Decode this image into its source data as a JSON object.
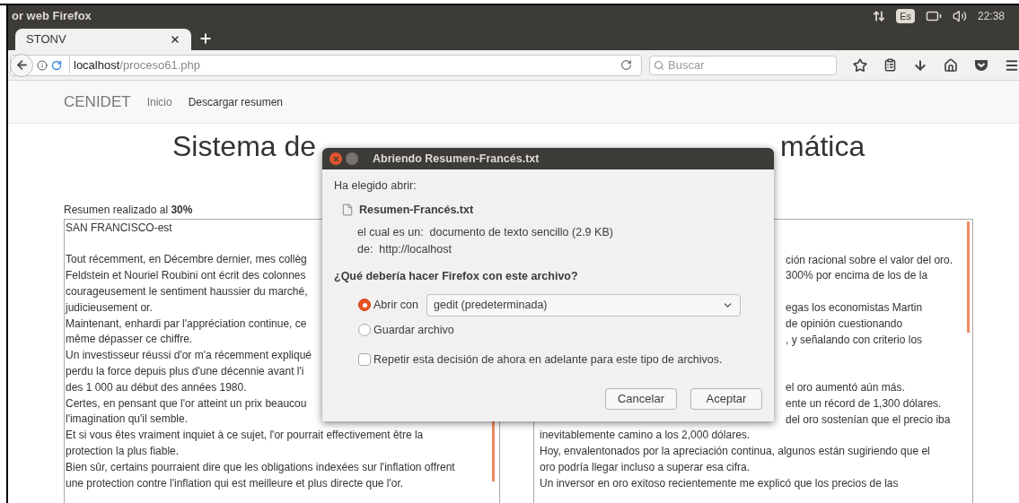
{
  "system_bar": {
    "window_title": "or web Firefox",
    "keyboard": "Es",
    "clock": "22:38"
  },
  "tabs": [
    {
      "label": "STONV",
      "selected": true
    }
  ],
  "address_bar": {
    "host": "localhost",
    "path": "/proceso61.php"
  },
  "search": {
    "placeholder": "Buscar"
  },
  "navbar": {
    "brand": "CENIDET",
    "links": [
      {
        "label": "Inicio",
        "selected": false
      },
      {
        "label": "Descargar resumen",
        "selected": true
      }
    ]
  },
  "page": {
    "title_left": "Sistema de",
    "title_right": "mática",
    "progress_label": "Resumen realizado al **30%**",
    "source_lines": [
      {
        "kind": "text",
        "text": "SAN FRANCISCO-est"
      },
      {
        "kind": "blank"
      },
      {
        "kind": "text",
        "text": "Tout récemment, en Décembre dernier, mes collèg"
      },
      {
        "kind": "text",
        "text": "Feldstein et Nouriel Roubini ont écrit des colonnes"
      },
      {
        "kind": "text",
        "text": "courageusement le sentiment haussier du marché,"
      },
      {
        "kind": "text",
        "text": "judicieusement or."
      },
      {
        "kind": "text",
        "text": "Maintenant, enhardi par l'appréciation continue, ce"
      },
      {
        "kind": "text",
        "text": "même dépasser ce chiffre."
      },
      {
        "kind": "text",
        "text": "Un investisseur réussi d'or m'a récemment expliqué"
      },
      {
        "kind": "text",
        "text": "perdu la force depuis plus d'une décennie avant l'i"
      },
      {
        "kind": "text",
        "text": "des 1 000 au début des années 1980."
      },
      {
        "kind": "text",
        "text": "Certes, en pensant que l'or atteint un prix beaucou"
      },
      {
        "kind": "text",
        "text": "l'imagination qu'il semble."
      },
      {
        "kind": "text",
        "text": "Et si vous êtes vraiment inquiet à ce sujet, l'or pourrait effectivement être la"
      },
      {
        "kind": "text",
        "text": "protection la plus fiable."
      },
      {
        "kind": "text",
        "text": "Bien sûr, certains pourraient dire que les obligations indexées sur l'inflation offrent"
      },
      {
        "kind": "text",
        "text": "une protection contre l'inflation qui est meilleure et plus directe que l'or."
      }
    ],
    "target_lines": [
      {
        "kind": "covered"
      },
      {
        "kind": "covered"
      },
      {
        "kind": "partial",
        "text": "ción racional sobre el valor del oro."
      },
      {
        "kind": "partial",
        "text": "300% por encima de los de la"
      },
      {
        "kind": "covered"
      },
      {
        "kind": "partial",
        "text": "egas los economistas Martin"
      },
      {
        "kind": "partial",
        "text": "de opinión cuestionando"
      },
      {
        "kind": "partial",
        "text": ", y señalando con criterio los"
      },
      {
        "kind": "covered"
      },
      {
        "kind": "covered"
      },
      {
        "kind": "partial",
        "text": "el oro aumentó aún más."
      },
      {
        "kind": "partial",
        "text": "ente un récord de 1,300 dólares."
      },
      {
        "kind": "partial",
        "text": "del oro sostenían que el precio iba"
      },
      {
        "kind": "full",
        "text": "inevitablemente camino a los 2,000 dólares."
      },
      {
        "kind": "full",
        "text": "Hoy, envalentonados por la apreciación continua, algunos están sugiriendo que el"
      },
      {
        "kind": "full",
        "text": "oro podría llegar incluso a superar esa cifra."
      },
      {
        "kind": "full",
        "text": "Un inversor en oro exitoso recientemente me explicó que los precios de las"
      }
    ]
  },
  "dialog": {
    "title": "Abriendo Resumen-Francés.txt",
    "intro": "Ha elegido abrir:",
    "file_name": "Resumen-Francés.txt",
    "type_line": "el cual es un:  documento de texto sencillo (2.9 KB)",
    "from_line": "de:  http://localhost",
    "question": "¿Qué debería hacer Firefox con este archivo?",
    "options": [
      {
        "label": "Abrir con",
        "selected": true
      },
      {
        "label": "Guardar archivo",
        "selected": false
      }
    ],
    "app_select": {
      "value": "gedit (predeterminada)"
    },
    "remember": {
      "label": "Repetir esta decisión de ahora en adelante para este tipo de archivos.",
      "checked": false
    },
    "buttons": [
      "Cancelar",
      "Aceptar"
    ]
  }
}
